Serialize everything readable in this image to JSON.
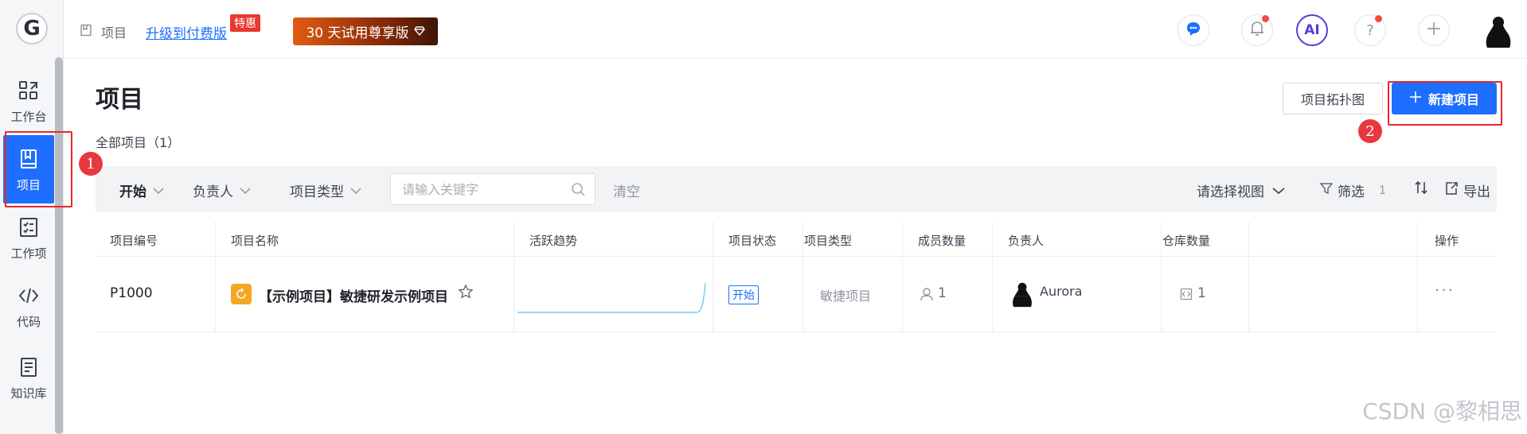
{
  "sidebar": {
    "logo": "G",
    "items": [
      {
        "label": "工作台",
        "icon": "dashboard-icon"
      },
      {
        "label": "项目",
        "icon": "project-book-icon"
      },
      {
        "label": "工作项",
        "icon": "checklist-icon"
      },
      {
        "label": "代码",
        "icon": "code-icon"
      },
      {
        "label": "知识库",
        "icon": "document-icon"
      }
    ]
  },
  "topbar": {
    "crumb": "项目",
    "upgrade_link": "升级到付费版",
    "promo_badge": "特惠",
    "trial_button": "30 天试用尊享版",
    "ai_label": "AI",
    "help_label": "?"
  },
  "page": {
    "title": "项目",
    "count_label": "全部项目（1）",
    "topology_button": "项目拓扑图",
    "new_button": "新建项目"
  },
  "filters": {
    "start": "开始",
    "owner": "负责人",
    "project_type": "项目类型",
    "search_placeholder": "请输入关键字",
    "clear": "清空",
    "view_select": "请选择视图",
    "filter": "筛选",
    "filter_count": "1",
    "export": "导出"
  },
  "table": {
    "columns": [
      "项目编号",
      "项目名称",
      "活跃趋势",
      "项目状态",
      "项目类型",
      "成员数量",
      "负责人",
      "仓库数量",
      "操作"
    ],
    "rows": [
      {
        "id": "P1000",
        "name": "【示例项目】敏捷研发示例项目",
        "status": "开始",
        "type": "敏捷项目",
        "members": "1",
        "owner": "Aurora",
        "repos": "1",
        "ops": "···"
      }
    ]
  },
  "annotations": {
    "one": "1",
    "two": "2"
  },
  "watermark": "CSDN @黎相思",
  "colors": {
    "primary": "#1e6fff",
    "annotation": "#e8272a",
    "sidebar_bg": "#f5f6f8",
    "filterbar_bg": "#f2f3f5"
  }
}
